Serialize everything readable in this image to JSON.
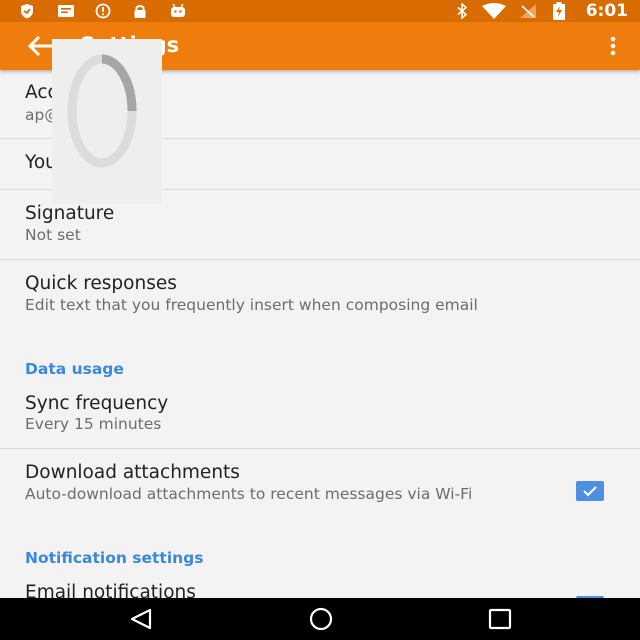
{
  "toolbar": {
    "title": "Settings"
  },
  "status_bar": {
    "time": "6:01"
  },
  "settings": {
    "account_name": {
      "title": "Account name",
      "summary": "ap@gmail.com"
    },
    "your_name": {
      "title": "Your name"
    },
    "signature": {
      "title": "Signature",
      "summary": "Not set"
    },
    "quick_responses": {
      "title": "Quick responses",
      "summary": "Edit text that you frequently insert when composing email"
    },
    "data_usage_header": "Data usage",
    "sync_frequency": {
      "title": "Sync frequency",
      "summary": "Every 15 minutes"
    },
    "download_attachments": {
      "title": "Download attachments",
      "summary": "Auto-download attachments to recent messages via Wi-Fi",
      "checked": true
    },
    "notification_settings_header": "Notification settings",
    "email_notifications": {
      "title": "Email notifications",
      "checked": true
    }
  },
  "colors": {
    "toolbar": "#ef7d0d",
    "status_bar": "#d96c00",
    "accent": "#3d88d8",
    "checkbox": "#4f8fe0"
  },
  "icons": {
    "status_left": [
      "shield-icon",
      "message-icon",
      "alert-icon",
      "lock-icon",
      "android-icon"
    ],
    "status_right": [
      "bluetooth-icon",
      "wifi-icon",
      "no-signal-icon",
      "battery-icon"
    ],
    "navigation": [
      "back-triangle-icon",
      "home-circle-icon",
      "recents-square-icon"
    ]
  }
}
